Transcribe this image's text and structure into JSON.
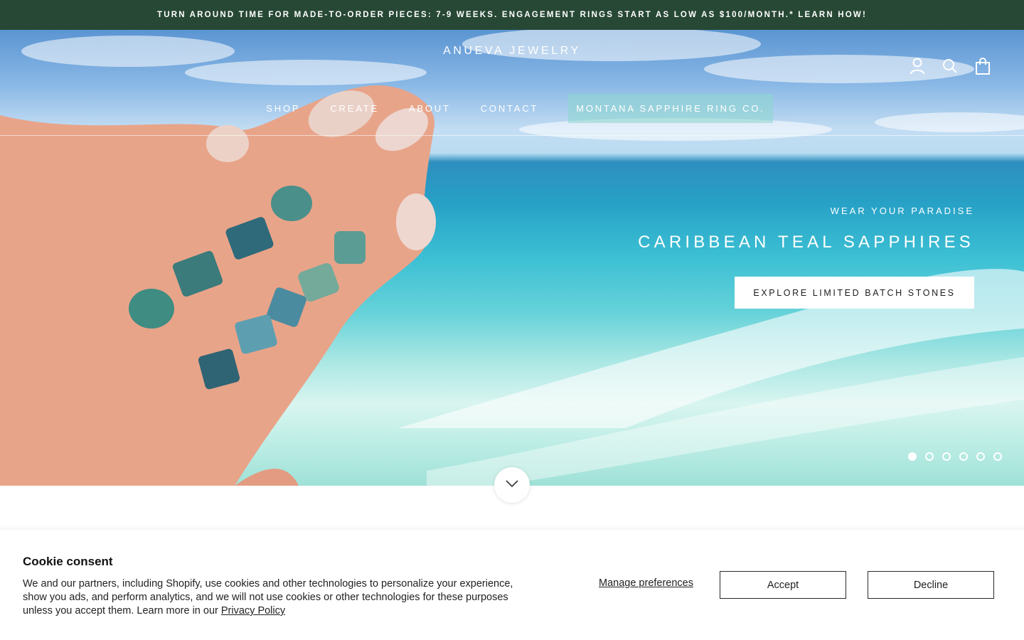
{
  "announcement": {
    "text": "TURN AROUND TIME FOR MADE-TO-ORDER PIECES: 7-9 WEEKS. ENGAGEMENT RINGS START AS LOW AS $100/MONTH.* LEARN HOW!"
  },
  "header": {
    "logo": "ANUEVA JEWELRY",
    "icons": [
      "account-icon",
      "search-icon",
      "cart-icon"
    ]
  },
  "nav": {
    "items": [
      "SHOP",
      "CREATE",
      "ABOUT",
      "CONTACT",
      "MONTANA SAPPHIRE RING CO."
    ]
  },
  "hero": {
    "eyebrow": "WEAR YOUR PARADISE",
    "title": "CARIBBEAN TEAL SAPPHIRES",
    "cta": "EXPLORE LIMITED BATCH STONES",
    "slide_count": 6,
    "active_slide": 1
  },
  "cookie": {
    "title": "Cookie consent",
    "body": "We and our partners, including Shopify, use cookies and other technologies to personalize your experience, show you ads, and perform analytics, and we will not use cookies or other technologies for these purposes unless you accept them. Learn more in our",
    "privacy_link": "Privacy Policy",
    "manage_label": "Manage preferences",
    "accept_label": "Accept",
    "decline_label": "Decline"
  },
  "colors": {
    "announcement_bg": "#274835",
    "text_white": "#ffffff"
  }
}
